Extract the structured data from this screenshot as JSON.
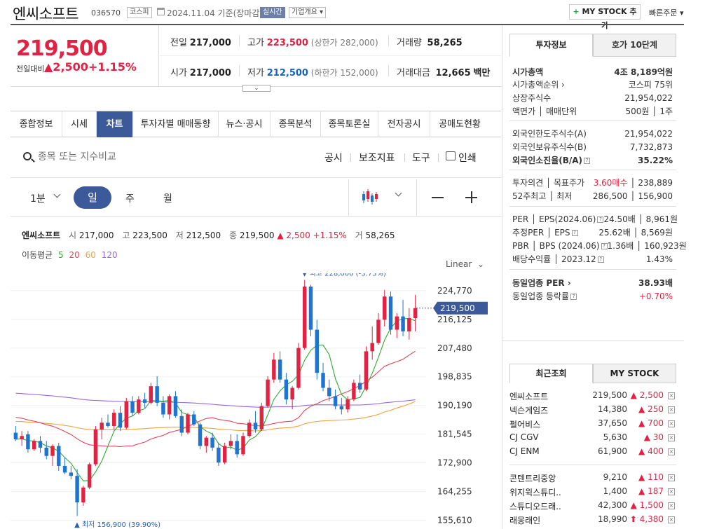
{
  "header": {
    "name": "엔씨소프트",
    "code": "036570",
    "market_tag": "코스피",
    "date": "2024.11.04",
    "date_suffix": "기준(장마감)",
    "realtime_tag": "실시간",
    "company_overview": "기업개요 ▾",
    "mystock_plus": "+",
    "mystock_btn": "MY STOCK 추가",
    "quick_order": "빠른주문 ▾"
  },
  "price": {
    "current": "219,500",
    "prev_label": "전일대비",
    "change_amt": "▲2,500",
    "change_pct": "+1.15%"
  },
  "quote": {
    "prev_close_label": "전일",
    "prev_close": "217,000",
    "high_label": "고가",
    "high": "223,500",
    "upper_limit": "(상한가 282,000)",
    "volume_label": "거래량",
    "volume": "58,265",
    "open_label": "시가",
    "open": "217,000",
    "low_label": "저가",
    "low": "212,500",
    "lower_limit": "(하한가 152,000)",
    "amount_label": "거래대금",
    "amount": "12,665",
    "amount_unit": "백만"
  },
  "tabs": [
    "종합정보",
    "시세",
    "차트",
    "투자자별 매매동향",
    "뉴스·공시",
    "종목분석",
    "종목토론실",
    "전자공시",
    "공매도현황"
  ],
  "toolbar": {
    "search_placeholder": "종목 또는 지수비교",
    "disclosure": "공시",
    "indicator": "보조지표",
    "tools": "도구",
    "print": "인쇄"
  },
  "periods": {
    "minute": "1분",
    "day": "일",
    "week": "주",
    "month": "월"
  },
  "ohlc": {
    "name": "엔씨소프트",
    "o_label": "시",
    "o": "217,000",
    "h_label": "고",
    "h": "223,500",
    "l_label": "저",
    "l": "212,500",
    "c_label": "종",
    "c": "219,500",
    "chg": "▲ 2,500",
    "pct": "+1.15%",
    "v_label": "거",
    "v": "58,265"
  },
  "ma": {
    "label": "이동평균",
    "p5": "5",
    "p20": "20",
    "p60": "60",
    "p120": "120",
    "colors": {
      "p5": "#31a831",
      "p20": "#e0475b",
      "p60": "#f0a040",
      "p120": "#9966dd"
    }
  },
  "scale": "Linear",
  "chart_data": {
    "type": "candlestick",
    "y_ticks": [
      "224,770",
      "216,125",
      "207,480",
      "198,835",
      "190,190",
      "181,545",
      "172,900",
      "164,255",
      "155,610"
    ],
    "y_tick_values": [
      224770,
      216125,
      207480,
      198835,
      190190,
      181545,
      172900,
      164255,
      155610
    ],
    "ylim": [
      153000,
      230000
    ],
    "current_label": "219,500",
    "current_value": 219500,
    "max_label": "▼ 최고 228,000 (-3.73%)",
    "max_value": 228000,
    "min_label": "▲ 최저 156,900 (39.90%)",
    "min_value": 156900,
    "up_color": "#e12343",
    "down_color": "#1f74d0",
    "candles": [
      [
        182000,
        184000,
        179500,
        180000
      ],
      [
        180000,
        182500,
        178000,
        181000
      ],
      [
        181500,
        182500,
        176000,
        177000
      ],
      [
        177000,
        180000,
        176500,
        179500
      ],
      [
        179500,
        181000,
        176000,
        177500
      ],
      [
        177500,
        179500,
        174000,
        175000
      ],
      [
        175000,
        178500,
        172000,
        178000
      ],
      [
        178000,
        179000,
        170500,
        172000
      ],
      [
        172000,
        174500,
        169500,
        170000
      ],
      [
        170000,
        172000,
        168000,
        169000
      ],
      [
        169000,
        171000,
        156900,
        161000
      ],
      [
        161000,
        166000,
        160000,
        165500
      ],
      [
        165500,
        173000,
        165000,
        172500
      ],
      [
        172500,
        184000,
        172000,
        183000
      ],
      [
        183000,
        186500,
        180000,
        185000
      ],
      [
        185000,
        187500,
        183500,
        184000
      ],
      [
        184000,
        189000,
        183000,
        188000
      ],
      [
        188000,
        190000,
        182500,
        183500
      ],
      [
        183500,
        192500,
        183000,
        191500
      ],
      [
        191500,
        193000,
        187000,
        188000
      ],
      [
        188000,
        193000,
        187500,
        192000
      ],
      [
        192000,
        194000,
        189500,
        191000
      ],
      [
        191000,
        197000,
        190500,
        196000
      ],
      [
        196000,
        199000,
        190000,
        191000
      ],
      [
        191000,
        193000,
        186500,
        187500
      ],
      [
        187500,
        193500,
        186000,
        193000
      ],
      [
        193000,
        194500,
        186500,
        187000
      ],
      [
        187000,
        189000,
        181000,
        182000
      ],
      [
        182000,
        188000,
        181500,
        187500
      ],
      [
        187500,
        188500,
        184000,
        184500
      ],
      [
        184500,
        185000,
        177000,
        178000
      ],
      [
        178000,
        181000,
        176000,
        180500
      ],
      [
        180500,
        182000,
        176500,
        177500
      ],
      [
        177500,
        179000,
        172000,
        173000
      ],
      [
        173000,
        179000,
        172500,
        178000
      ],
      [
        178000,
        181500,
        177000,
        179500
      ],
      [
        179500,
        181500,
        174500,
        175500
      ],
      [
        175500,
        182000,
        175000,
        181000
      ],
      [
        181000,
        186000,
        180500,
        185000
      ],
      [
        185000,
        188500,
        182000,
        183000
      ],
      [
        183000,
        191000,
        182500,
        190000
      ],
      [
        190000,
        199000,
        189500,
        198000
      ],
      [
        198000,
        206000,
        197000,
        204000
      ],
      [
        204000,
        206500,
        197000,
        198000
      ],
      [
        198000,
        200000,
        190500,
        192000
      ],
      [
        192000,
        196000,
        189000,
        195500
      ],
      [
        195500,
        209000,
        195000,
        207500
      ],
      [
        207500,
        228000,
        207000,
        226000
      ],
      [
        226000,
        226500,
        211000,
        213000
      ],
      [
        213000,
        216000,
        198000,
        200000
      ],
      [
        200000,
        203000,
        194500,
        195500
      ],
      [
        195500,
        198000,
        191500,
        193000
      ],
      [
        193000,
        195000,
        189000,
        190000
      ],
      [
        190000,
        192500,
        187500,
        189000
      ],
      [
        189000,
        193000,
        188000,
        192000
      ],
      [
        192000,
        198000,
        191500,
        197000
      ],
      [
        197000,
        199500,
        194000,
        195000
      ],
      [
        195000,
        208000,
        194500,
        206500
      ],
      [
        206500,
        214000,
        204000,
        209000
      ],
      [
        209000,
        218000,
        208500,
        216000
      ],
      [
        216000,
        225000,
        214000,
        223000
      ],
      [
        223000,
        224500,
        211500,
        213000
      ],
      [
        213000,
        218000,
        210500,
        217000
      ],
      [
        217000,
        222000,
        211000,
        212500
      ],
      [
        212500,
        219500,
        210000,
        216500
      ],
      [
        216500,
        223500,
        212500,
        219500
      ]
    ]
  },
  "invest_tabs": {
    "info": "투자정보",
    "ask10": "호가 10단계"
  },
  "invest": [
    {
      "k": "시가총액",
      "v": "4조 8,189억원",
      "bold": true
    },
    {
      "k": "시가총액순위 ›",
      "v": "코스피 75위"
    },
    {
      "k": "상장주식수",
      "v": "21,954,022"
    },
    {
      "k": "액면가 │ 매매단위",
      "v": "500원 │ 1주"
    },
    {
      "k": "외국인한도주식수(A)",
      "v": "21,954,022"
    },
    {
      "k": "외국인보유주식수(B)",
      "v": "7,732,873"
    },
    {
      "k": "외국인소진율(B/A)",
      "v": "35.22%",
      "bold": true,
      "q": "?"
    },
    {
      "k": "투자의견 │ 목표주가",
      "v": "3.60매수 │ 238,889",
      "vred": "3.60매수"
    },
    {
      "k": "52주최고 │ 최저",
      "v": "286,500 │ 156,900"
    },
    {
      "k": "PER │ EPS(2024.06)",
      "v": "24.50배 │ 8,961원",
      "q": "?"
    },
    {
      "k": "추정PER │ EPS",
      "v": "25.62배 │ 8,569원",
      "q": "?"
    },
    {
      "k": "PBR │ BPS (2024.06)",
      "v": "1.36배 │ 160,923원",
      "q": "?"
    },
    {
      "k": "배당수익률 │ 2023.12",
      "v": "1.43%",
      "q": "?"
    },
    {
      "k": "동일업종 PER ›",
      "v": "38.93배",
      "bold": true
    },
    {
      "k": "동일업종 등락률",
      "v": "+0.70%",
      "q": "?",
      "vup": true
    }
  ],
  "recent_tabs": {
    "recent": "최근조회",
    "mystock": "MY STOCK"
  },
  "recent": [
    {
      "n": "엔씨소프트",
      "p": "219,500",
      "c": "▲ 2,500"
    },
    {
      "n": "넥슨게임즈",
      "p": "14,380",
      "c": "▲ 250"
    },
    {
      "n": "펄어비스",
      "p": "37,650",
      "c": "▲ 700"
    },
    {
      "n": "CJ CGV",
      "p": "5,630",
      "c": "▲ 30"
    },
    {
      "n": "CJ ENM",
      "p": "61,900",
      "c": "▲ 400"
    },
    {
      "n": "콘텐트리중앙",
      "p": "9,210",
      "c": "▲ 110"
    },
    {
      "n": "위지윅스튜디..",
      "p": "1,400",
      "c": "▲ 187"
    },
    {
      "n": "스튜디오드래..",
      "p": "42,300",
      "c": "▲ 1,500"
    },
    {
      "n": "래몽래인",
      "p": "18,990",
      "c": "⬆ 4,380"
    }
  ],
  "close_mark": "×"
}
